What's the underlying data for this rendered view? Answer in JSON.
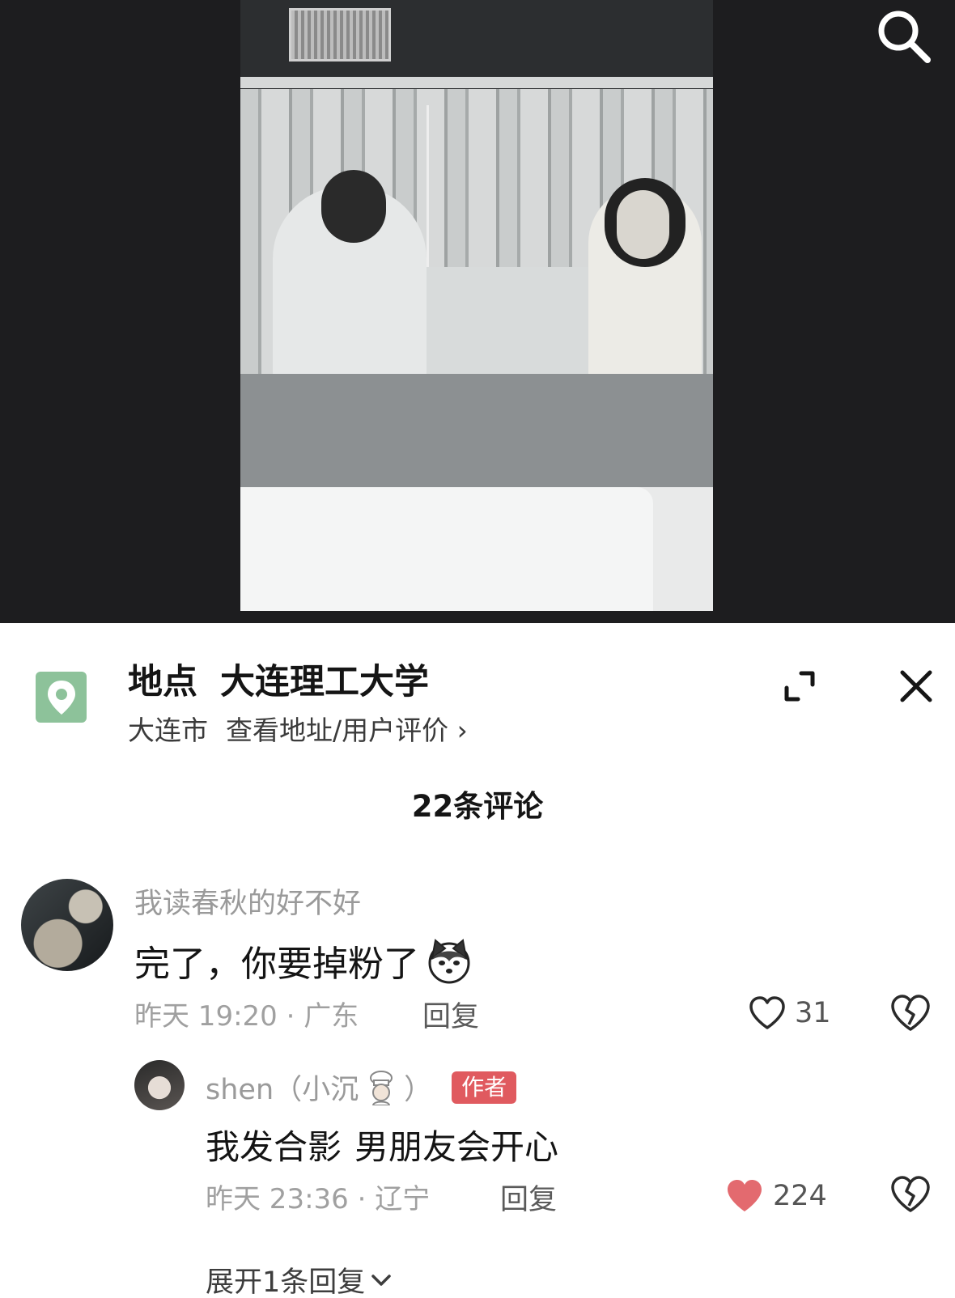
{
  "icons": {
    "search": "search-icon",
    "location": "location-pin-icon",
    "expand": "expand-icon",
    "close": "close-icon",
    "like": "heart-icon",
    "dislike": "broken-heart-icon",
    "expand_chevron": "chevron-down-icon"
  },
  "colors": {
    "location_icon_bg": "#8dc29a",
    "author_badge": "#e05a5f",
    "liked_heart": "#e36a6f"
  },
  "location": {
    "label": "地点",
    "name": "大连理工大学",
    "city": "大连市",
    "link": "查看地址/用户评价 ›"
  },
  "comments_header": {
    "count_label": "22条评论"
  },
  "comment": {
    "username": "我读春秋的好不好",
    "text": "完了，你要掉粉了",
    "meta": "昨天 19:20 · 广东",
    "reply_label": "回复",
    "like_count": "31",
    "liked": false
  },
  "reply": {
    "username": "shen（小沉",
    "username_suffix": "）",
    "author_badge": "作者",
    "text_part1": "我发合影",
    "text_part2": "男朋友会开心",
    "meta": "昨天 23:36 · 辽宁",
    "reply_label": "回复",
    "like_count": "224",
    "liked": true
  },
  "expand_replies": {
    "label": "展开1条回复"
  }
}
